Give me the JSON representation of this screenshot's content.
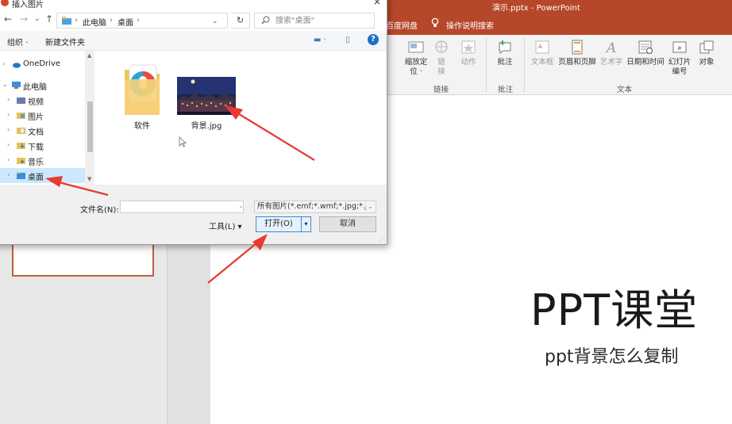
{
  "colors": {
    "ppt_accent": "#b7472a",
    "arrow": "#e8392f",
    "selection": "#cce8ff"
  },
  "ppt": {
    "window_title": "演示.pptx  -  PowerPoint",
    "tabs": [
      {
        "label": "百度网盘"
      },
      {
        "label": "操作说明搜索"
      }
    ],
    "ribbon": {
      "buttons": [
        {
          "label": "缩放定\n位 ·",
          "icon": "zoom-icon"
        },
        {
          "label": "链\n接",
          "icon": "link-icon"
        },
        {
          "label": "动作",
          "icon": "action-icon"
        },
        {
          "label": "批注",
          "icon": "comment-icon"
        },
        {
          "label": "文本框",
          "icon": "textbox-icon"
        },
        {
          "label": "页眉和页脚",
          "icon": "header-footer-icon"
        },
        {
          "label": "艺术字",
          "icon": "wordart-icon"
        },
        {
          "label": "日期和时间",
          "icon": "datetime-icon"
        },
        {
          "label": "幻灯片\n编号",
          "icon": "slide-number-icon"
        },
        {
          "label": "对象",
          "icon": "object-icon"
        }
      ],
      "groups": [
        {
          "label": "链接"
        },
        {
          "label": "批注"
        },
        {
          "label": "文本"
        }
      ]
    },
    "slide": {
      "title": "PPT课堂",
      "subtitle": "ppt背景怎么复制"
    }
  },
  "dialog": {
    "title": "插入图片",
    "close": "×",
    "breadcrumbs": [
      "此电脑",
      "›",
      "桌面",
      "›"
    ],
    "nav": {
      "back": "←",
      "forward": "→",
      "recent": "⌄",
      "up": "↑",
      "refresh": "↻",
      "dropdown": "⌄"
    },
    "search_placeholder": "搜索\"桌面\"",
    "commands": {
      "organize": "组织 ·",
      "new_folder": "新建文件夹",
      "view": "▬ ·",
      "preview": "▯",
      "help": "?"
    },
    "tree": [
      {
        "label": "OneDrive"
      },
      {
        "label": "此电脑"
      },
      {
        "label": "视频"
      },
      {
        "label": "图片"
      },
      {
        "label": "文档"
      },
      {
        "label": "下载"
      },
      {
        "label": "音乐"
      },
      {
        "label": "桌面",
        "selected": true
      }
    ],
    "files": [
      {
        "name": "软件",
        "icon": "folder-icon"
      },
      {
        "name": "背景.jpg",
        "icon": "image-thumbnail"
      }
    ],
    "filename_label": "文件名(N):",
    "filename_value": "",
    "filter": "所有图片(*.emf;*.wmf;*.jpg;*.jp",
    "tools_label": "工具(L)  ▾",
    "open_label": "打开(O)",
    "open_split": "▾",
    "cancel_label": "取消"
  }
}
